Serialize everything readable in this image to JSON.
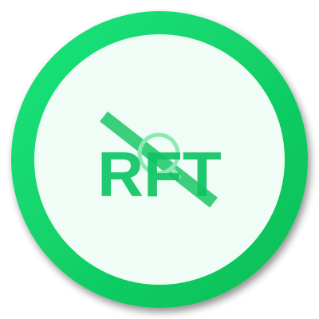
{
  "logo": {
    "text": "RFT",
    "colors": {
      "ring_light": "#19e57c",
      "ring_dark": "#0bbd55",
      "inner_fill": "#f0fcf6",
      "text_fill": "#0ec463",
      "slash_stroke": "#0fc45f",
      "lens_stroke": "#72e6a3",
      "shadow": "#8a8a8a"
    },
    "icon_name": "no-search-logo"
  }
}
